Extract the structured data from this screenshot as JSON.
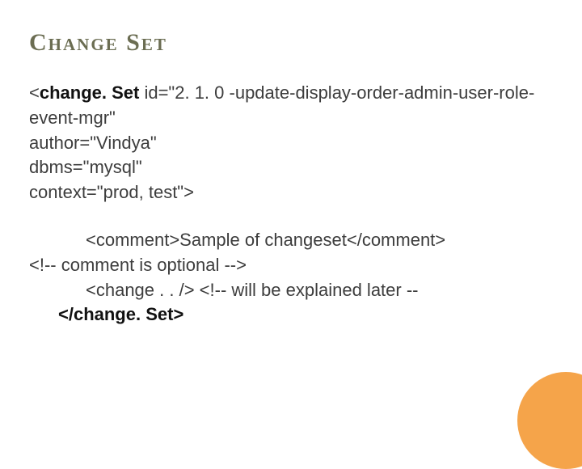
{
  "title": "Change Set",
  "code": {
    "open_tag_prefix": "<",
    "open_tag_name": "change. Set",
    "attr_id": " id=\"2. 1. 0 -update-display-order-admin-user-role-event-mgr\"",
    "attr_author": "author=\"Vindya\"",
    "attr_dbms": "dbms=\"mysql\"",
    "attr_context": "context=\"prod, test\">",
    "comment_sample": "<comment>Sample of changeset</comment>",
    "comment_optional": "<!-- comment is optional -->",
    "change_line": "<change . . /> <!-- will be explained later --",
    "close_tag": "</change. Set>"
  },
  "accent_color": "#f5a44a"
}
